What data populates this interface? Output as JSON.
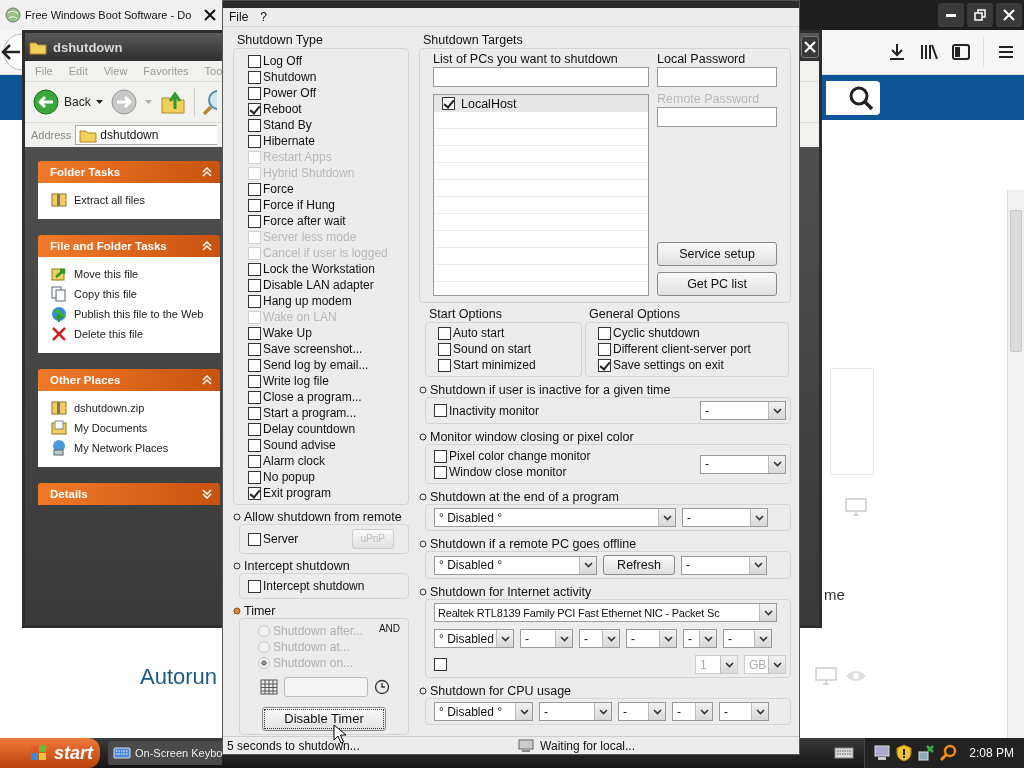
{
  "browser": {
    "tab_title": "Free Windows Boot Software - Do",
    "page_texts": [
      {
        "text": "Autorun",
        "kind": "heading"
      },
      {
        "text": "me",
        "kind": "body"
      }
    ]
  },
  "explorer": {
    "title": "dshutdown",
    "menu": [
      "File",
      "Edit",
      "View",
      "Favorites",
      "Too"
    ],
    "back_label": "Back",
    "address_label": "Address",
    "address_value": "dshutdown",
    "panels": [
      {
        "title": "Folder Tasks",
        "expanded": true,
        "items": [
          {
            "label": "Extract all files",
            "kind": "archive"
          }
        ]
      },
      {
        "title": "File and Folder Tasks",
        "expanded": true,
        "items": [
          {
            "label": "Move this file",
            "kind": "move"
          },
          {
            "label": "Copy this file",
            "kind": "copy"
          },
          {
            "label": "Publish this file to the Web",
            "kind": "globe"
          },
          {
            "label": "Delete this file",
            "kind": "delete"
          }
        ]
      },
      {
        "title": "Other Places",
        "expanded": true,
        "items": [
          {
            "label": "dshutdown.zip",
            "kind": "archive"
          },
          {
            "label": "My Documents",
            "kind": "documents"
          },
          {
            "label": "My Network Places",
            "kind": "network"
          }
        ]
      },
      {
        "title": "Details",
        "expanded": false
      }
    ]
  },
  "app": {
    "menu": [
      "File",
      "?"
    ],
    "shutdown_type": {
      "title": "Shutdown Type",
      "options": [
        {
          "label": "Log Off",
          "checked": false,
          "disabled": false
        },
        {
          "label": "Shutdown",
          "checked": false,
          "disabled": false
        },
        {
          "label": "Power Off",
          "checked": false,
          "disabled": false
        },
        {
          "label": "Reboot",
          "checked": true,
          "disabled": false
        },
        {
          "label": "Stand By",
          "checked": false,
          "disabled": false
        },
        {
          "label": "Hibernate",
          "checked": false,
          "disabled": false
        },
        {
          "label": "Restart Apps",
          "checked": false,
          "disabled": true
        },
        {
          "label": "Hybrid Shutdown",
          "checked": false,
          "disabled": true
        },
        {
          "label": "Force",
          "checked": false,
          "disabled": false
        },
        {
          "label": "Force if Hung",
          "checked": false,
          "disabled": false
        },
        {
          "label": "Force after wait",
          "checked": false,
          "disabled": false
        },
        {
          "label": "Server less mode",
          "checked": false,
          "disabled": true
        },
        {
          "label": "Cancel if user is logged",
          "checked": false,
          "disabled": true
        },
        {
          "label": "Lock the Workstation",
          "checked": false,
          "disabled": false
        },
        {
          "label": "Disable LAN adapter",
          "checked": false,
          "disabled": false
        },
        {
          "label": "Hang up modem",
          "checked": false,
          "disabled": false
        },
        {
          "label": "Wake on LAN",
          "checked": false,
          "disabled": true
        },
        {
          "label": "Wake Up",
          "checked": false,
          "disabled": false
        },
        {
          "label": "Save screenshot...",
          "checked": false,
          "disabled": false
        },
        {
          "label": "Send log by email...",
          "checked": false,
          "disabled": false
        },
        {
          "label": "Write log file",
          "checked": false,
          "disabled": false
        },
        {
          "label": "Close a program...",
          "checked": false,
          "disabled": false
        },
        {
          "label": "Start a program...",
          "checked": false,
          "disabled": false
        },
        {
          "label": "Delay countdown",
          "checked": false,
          "disabled": false
        },
        {
          "label": "Sound advise",
          "checked": false,
          "disabled": false
        },
        {
          "label": "Alarm clock",
          "checked": false,
          "disabled": false
        },
        {
          "label": "No popup",
          "checked": false,
          "disabled": false
        },
        {
          "label": "Exit program",
          "checked": true,
          "disabled": false
        }
      ]
    },
    "remote": {
      "title": "Allow shutdown from remote",
      "active": false,
      "server": {
        "label": "Server",
        "checked": false
      },
      "upnp": {
        "label": "uPnP",
        "disabled": true
      }
    },
    "intercept": {
      "title": "Intercept shutdown",
      "active": false,
      "option": {
        "label": "Intercept shutdown",
        "checked": false
      }
    },
    "timer": {
      "title": "Timer",
      "active": true,
      "logic": "AND",
      "modes": [
        {
          "label": "Shutdown after...",
          "selected": false,
          "disabled": true
        },
        {
          "label": "Shutdown at...",
          "selected": false,
          "disabled": true
        },
        {
          "label": "Shutdown on...",
          "selected": true,
          "disabled": true
        }
      ],
      "date_field": {
        "disabled": true
      },
      "button": "Disable Timer"
    },
    "targets": {
      "title": "Shutdown Targets",
      "list_label": "List of PCs you want to shutdown",
      "local_password_label": "Local Password",
      "remote_password_label": "Remote Password",
      "remote_password_disabled": true,
      "pcs": [
        {
          "name": "LocalHost",
          "checked": true,
          "selected": true
        }
      ],
      "buttons": [
        "Service setup",
        "Get PC list"
      ]
    },
    "start_options": {
      "title": "Start Options",
      "options": [
        {
          "label": "Auto start",
          "checked": false
        },
        {
          "label": "Sound on start",
          "checked": false
        },
        {
          "label": "Start minimized",
          "checked": false
        }
      ]
    },
    "general_options": {
      "title": "General Options",
      "options": [
        {
          "label": "Cyclic shutdown",
          "checked": false
        },
        {
          "label": "Different client-server port",
          "checked": false
        },
        {
          "label": "Save settings on exit",
          "checked": true
        }
      ]
    },
    "sections": [
      {
        "title": "Shutdown if user is inactive for a given time",
        "active": false,
        "rows": [
          {
            "items": [
              {
                "kind": "checkbox",
                "label": "Inactivity monitor",
                "checked": false
              },
              {
                "kind": "dropdown",
                "value": "-",
                "disabled": false
              }
            ]
          }
        ]
      },
      {
        "title": "Monitor window closing or pixel color",
        "active": false,
        "rows": [
          {
            "items": [
              {
                "kind": "checkbox",
                "label": "Pixel color change monitor",
                "checked": false
              },
              {
                "kind": "checkbox",
                "label": "Window close monitor",
                "checked": false
              },
              {
                "kind": "dropdown",
                "value": "-",
                "disabled": false
              }
            ]
          }
        ]
      },
      {
        "title": "Shutdown at the end of a program",
        "active": false,
        "rows": [
          {
            "items": [
              {
                "kind": "dropdown",
                "value": "° Disabled °",
                "disabled": false
              },
              {
                "kind": "dropdown",
                "value": "-",
                "disabled": false
              }
            ]
          }
        ]
      },
      {
        "title": "Shutdown if a remote PC goes offline",
        "active": false,
        "rows": [
          {
            "items": [
              {
                "kind": "dropdown",
                "value": "° Disabled °",
                "disabled": false
              },
              {
                "kind": "button",
                "label": "Refresh"
              },
              {
                "kind": "dropdown",
                "value": "-",
                "disabled": false
              }
            ]
          }
        ]
      },
      {
        "title": "Shutdown for Internet activity",
        "active": false,
        "rows": [
          {
            "items": [
              {
                "kind": "dropdown",
                "value": "Realtek RTL8139 Family PCI Fast Ethernet NIC - Packet Sc",
                "disabled": false
              }
            ]
          },
          {
            "items": [
              {
                "kind": "dropdown",
                "value": "° Disabled",
                "disabled": false
              },
              {
                "kind": "dropdown",
                "value": "-",
                "disabled": false
              },
              {
                "kind": "dropdown",
                "value": "-",
                "disabled": false
              },
              {
                "kind": "dropdown",
                "value": "-",
                "disabled": false
              },
              {
                "kind": "dropdown",
                "value": "-",
                "disabled": false
              },
              {
                "kind": "dropdown",
                "value": "-",
                "disabled": false
              }
            ]
          },
          {
            "items": [
              {
                "kind": "checkbox",
                "checked": false
              },
              {
                "kind": "dropdown",
                "value": "1",
                "disabled": true
              },
              {
                "kind": "dropdown",
                "value": "GB",
                "disabled": true
              }
            ]
          }
        ]
      },
      {
        "title": "Shutdown for CPU usage",
        "active": false,
        "rows": [
          {
            "items": [
              {
                "kind": "dropdown",
                "value": "° Disabled °",
                "disabled": false
              },
              {
                "kind": "dropdown",
                "value": "-",
                "disabled": false
              },
              {
                "kind": "dropdown",
                "value": "-",
                "disabled": false
              },
              {
                "kind": "dropdown",
                "value": "-",
                "disabled": false
              },
              {
                "kind": "dropdown",
                "value": "-",
                "disabled": false
              }
            ]
          }
        ]
      }
    ],
    "status": [
      "5 seconds to shutdown...",
      "Waiting for local..."
    ]
  },
  "taskbar": {
    "start": "start",
    "tasks": [
      {
        "label": "On-Screen Keybo"
      }
    ],
    "clock": "2:08 PM"
  }
}
